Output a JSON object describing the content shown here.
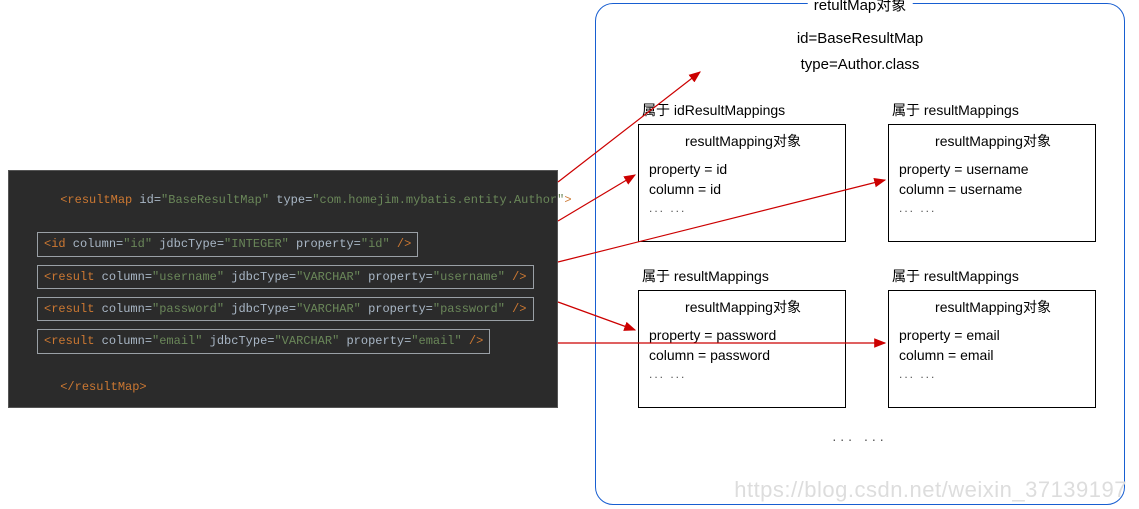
{
  "code": {
    "openTag": "resultMap",
    "openAttrs": " id=",
    "idVal": "\"BaseResultMap\"",
    "typeAttr": " type=",
    "typeVal": "\"com.homejim.mybatis.entity.Author\"",
    "gt": ">",
    "lt": "<",
    "slashGt": " />",
    "closeTag": "</resultMap>",
    "rows": [
      {
        "tag": "id",
        "column": "\"id\"",
        "jdbc": "\"INTEGER\"",
        "prop": "\"id\""
      },
      {
        "tag": "result",
        "column": "\"username\"",
        "jdbc": "\"VARCHAR\"",
        "prop": "\"username\""
      },
      {
        "tag": "result",
        "column": "\"password\"",
        "jdbc": "\"VARCHAR\"",
        "prop": "\"password\""
      },
      {
        "tag": "result",
        "column": "\"email\"",
        "jdbc": "\"VARCHAR\"",
        "prop": "\"email\""
      }
    ],
    "kw_column": " column=",
    "kw_jdbc": " jdbcType=",
    "kw_prop": " property="
  },
  "bigBox": {
    "title": "retultMap对象",
    "sub1": "id=BaseResultMap",
    "sub2": "type=Author.class",
    "dots": "... ...",
    "mappings": [
      {
        "label": "属于 idResultMappings",
        "obj": "resultMapping对象",
        "prop": "property = id",
        "col": "column = id"
      },
      {
        "label": "属于 resultMappings",
        "obj": "resultMapping对象",
        "prop": "property = username",
        "col": "column = username"
      },
      {
        "label": "属于 resultMappings",
        "obj": "resultMapping对象",
        "prop": "property = password",
        "col": "column = password"
      },
      {
        "label": "属于 resultMappings",
        "obj": "resultMapping对象",
        "prop": "property = email",
        "col": "column = email"
      }
    ]
  },
  "watermark": "https://blog.csdn.net/weixin_37139197",
  "dotsSmall": "... ..."
}
